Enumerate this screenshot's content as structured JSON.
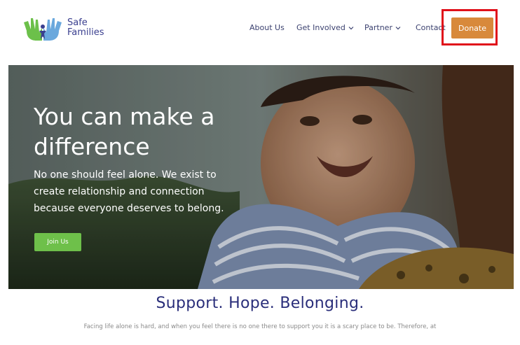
{
  "header": {
    "brand": {
      "line1": "Safe",
      "line2": "Families"
    },
    "nav": [
      {
        "label": "About Us",
        "has_dropdown": false
      },
      {
        "label": "Get Involved",
        "has_dropdown": true
      },
      {
        "label": "Partner",
        "has_dropdown": true
      },
      {
        "label": "Contact",
        "has_dropdown": false
      }
    ],
    "donate_label": "Donate"
  },
  "hero": {
    "title": "You can make a difference",
    "subtitle": "No one should feel alone. We exist to create relationship and connection because everyone deserves to belong.",
    "cta_label": "Join Us"
  },
  "section": {
    "title": "Support. Hope. Belonging.",
    "body": "Facing life alone is hard, and when you feel there is no one there to support you it is a scary place to be. Therefore, at"
  },
  "colors": {
    "brand_blue": "#3a3f8f",
    "donate": "#d8893b",
    "join": "#6ec04a",
    "highlight": "#e0101a"
  }
}
